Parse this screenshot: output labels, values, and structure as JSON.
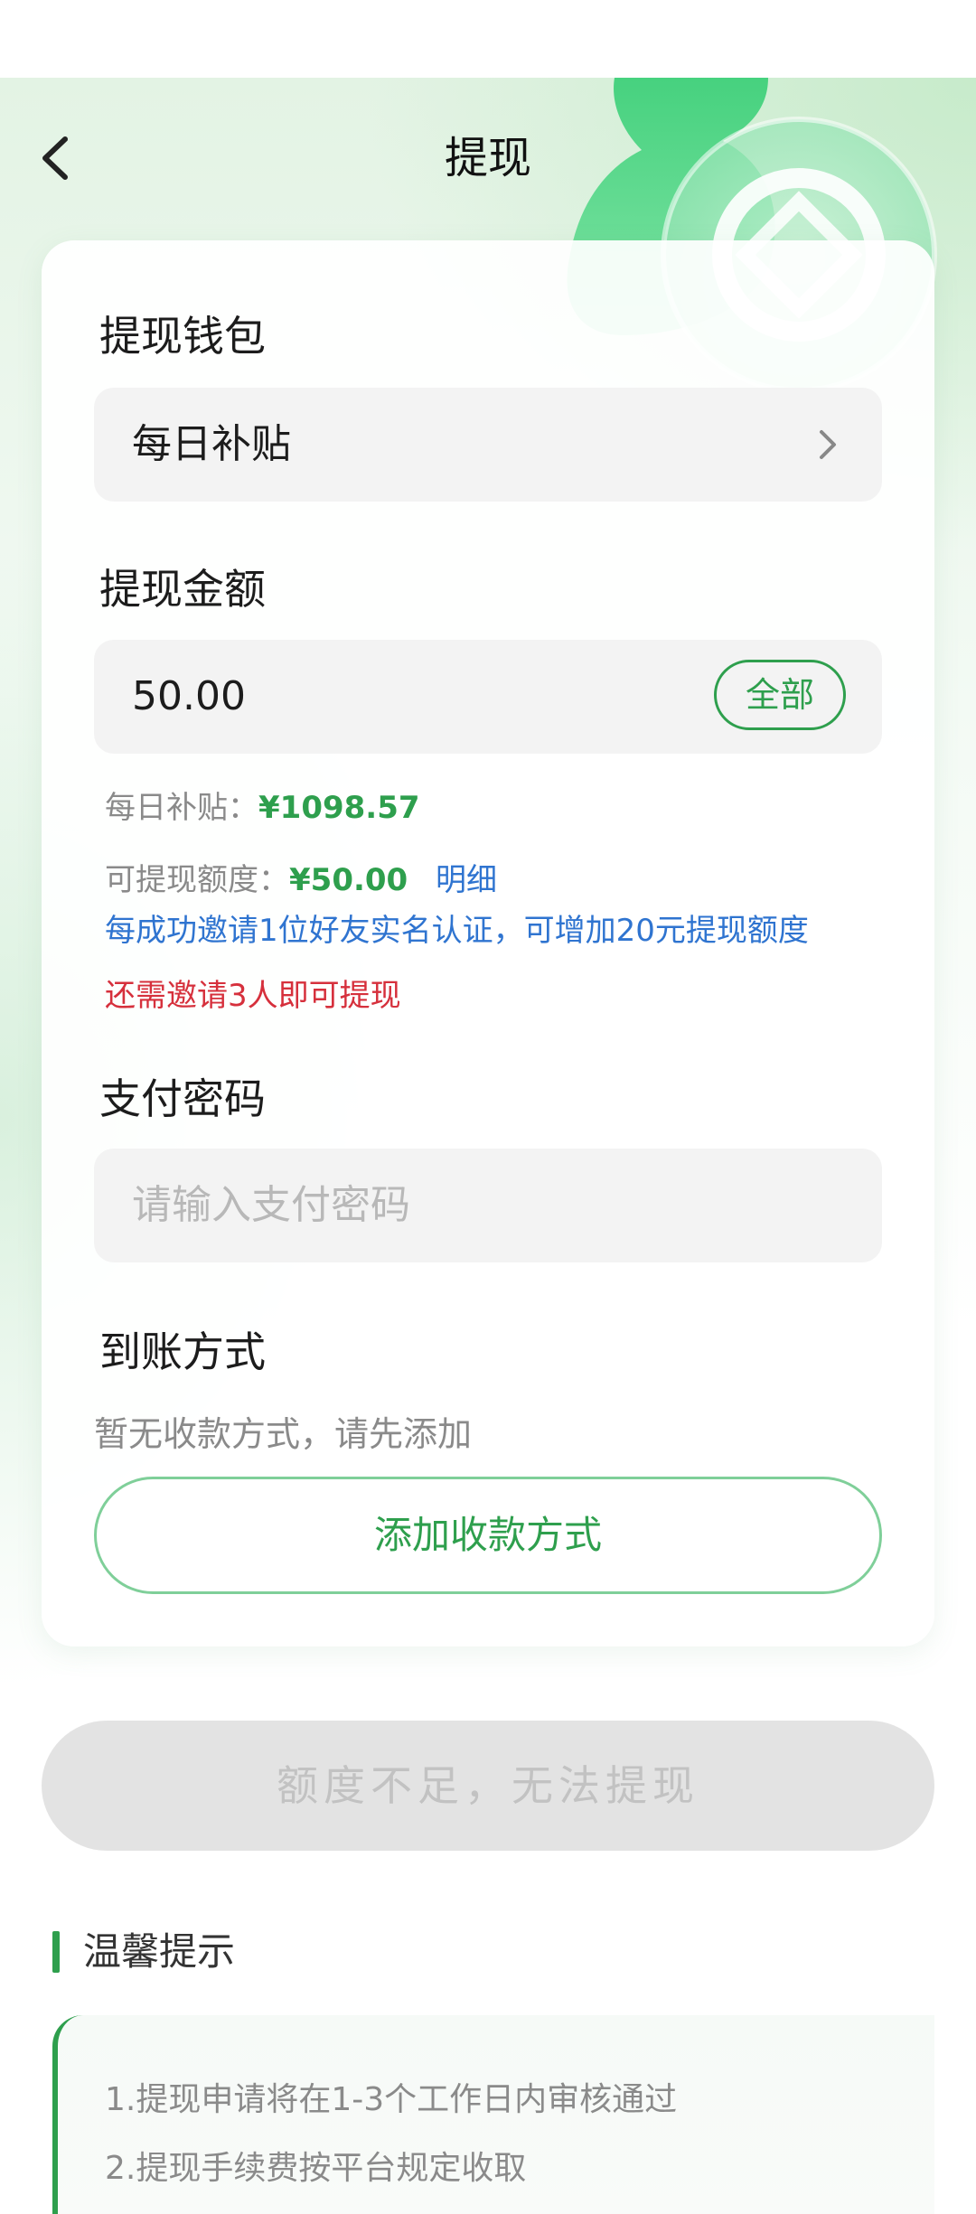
{
  "header": {
    "title": "提现",
    "back_icon": "chevron-left-icon"
  },
  "wallet": {
    "label": "提现钱包",
    "value": "每日补贴"
  },
  "amount": {
    "label": "提现金额",
    "value": "50.00",
    "all_button": "全部"
  },
  "balance": {
    "label": "每日补贴：",
    "value": "¥1098.57"
  },
  "quota": {
    "label": "可提现额度：",
    "value": "¥50.00",
    "detail_link": "明细",
    "invite_hint": "每成功邀请1位好友实名认证，可增加20元提现额度",
    "remaining_hint": "还需邀请3人即可提现"
  },
  "password": {
    "label": "支付密码",
    "placeholder": "请输入支付密码"
  },
  "payout": {
    "label": "到账方式",
    "empty_text": "暂无收款方式，请先添加",
    "add_button": "添加收款方式"
  },
  "submit_button": "额度不足，无法提现",
  "tips": {
    "title": "温馨提示",
    "items": [
      "1.提现申请将在1-3个工作日内审核通过",
      "2.提现手续费按平台规定收取"
    ]
  },
  "colors": {
    "accent_green": "#2e9f4d",
    "link_blue": "#2f74d0",
    "warning_red": "#d6303c"
  }
}
